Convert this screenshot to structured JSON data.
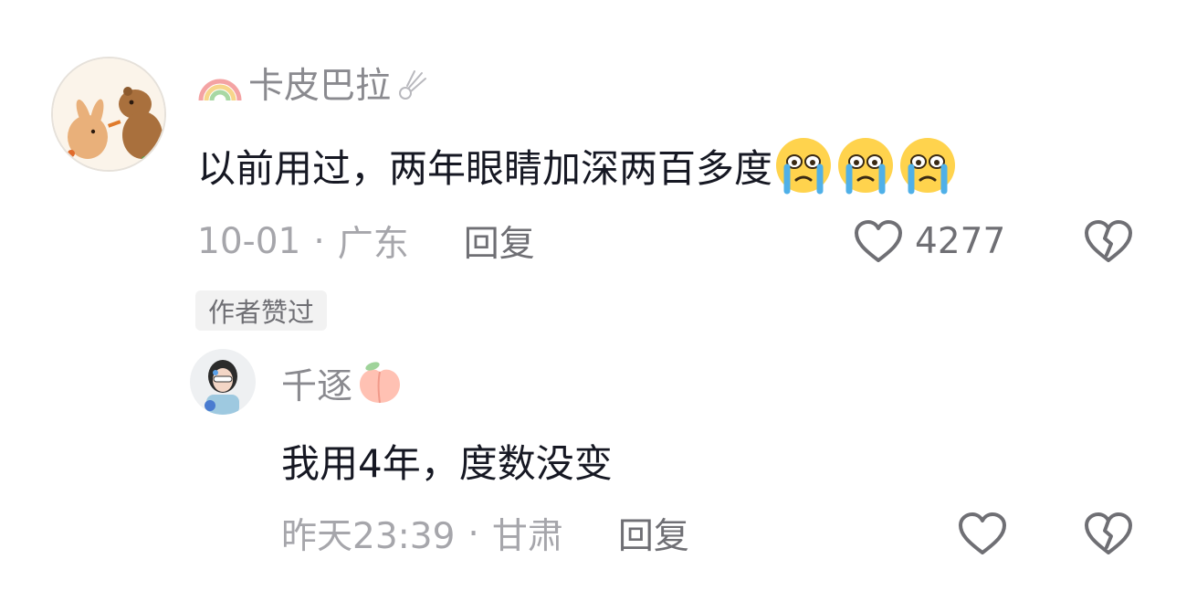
{
  "comment": {
    "username": "卡皮巴拉",
    "text": "以前用过，两年眼睛加深两百多度",
    "emoji_count": 3,
    "emoji": "crying-face-emoji",
    "date": "10-01",
    "separator": "·",
    "location": "广东",
    "reply_label": "回复",
    "like_count": "4277",
    "author_liked_badge": "作者赞过"
  },
  "reply": {
    "username": "千逐",
    "text": "我用4年，度数没变",
    "date": "昨天23:39",
    "separator": "·",
    "location": "甘肃",
    "reply_label": "回复"
  },
  "colors": {
    "primary_text": "#161823",
    "secondary_text": "#8a8a8f",
    "tertiary_text": "#a6a6ab",
    "action_text": "#6f6f74",
    "badge_bg": "#f2f2f2"
  }
}
